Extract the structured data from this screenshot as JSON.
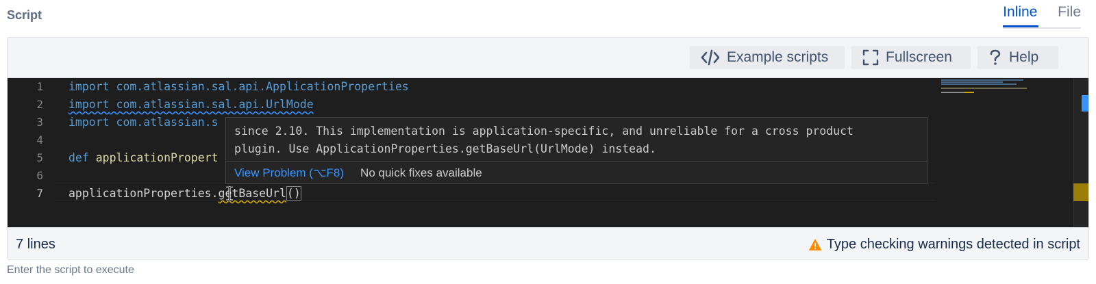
{
  "field": {
    "label": "Script",
    "helper": "Enter the script to execute"
  },
  "tabs": [
    {
      "label": "Inline",
      "selected": true
    },
    {
      "label": "File",
      "selected": false
    }
  ],
  "toolbar": {
    "example_label": "Example scripts",
    "fullscreen_label": "Fullscreen",
    "help_label": "Help"
  },
  "editor": {
    "line_numbers": [
      "1",
      "2",
      "3",
      "4",
      "5",
      "6",
      "7"
    ],
    "active_line": 7,
    "lines": {
      "l1_kw": "import",
      "l1_rest": " com.atlassian.sal.api.ApplicationProperties",
      "l2_kw": "import",
      "l2_rest": " com.atlassian.sal.api.UrlMode",
      "l3_kw": "import",
      "l3_rest": " com.atlassian.s",
      "l5_kw": "def",
      "l5_rest": " applicationPropert",
      "l7_obj": "applicationProperties.",
      "l7_method": "getBaseUrl",
      "l7_parens": "()"
    }
  },
  "hover": {
    "message_line1": "since 2.10. This implementation is application-specific, and unreliable for a cross product",
    "message_line2": "plugin. Use ApplicationProperties.getBaseUrl(UrlMode) instead.",
    "view_problem": "View Problem (⌥F8)",
    "no_fixes": "No quick fixes available"
  },
  "status": {
    "lines_count": "7 lines",
    "warning_text": "Type checking warnings detected in script",
    "warning_color": "#ff8b00"
  },
  "icons": [
    "code-icon",
    "fullscreen-icon",
    "help-icon",
    "warning-icon",
    "text-cursor-icon"
  ]
}
